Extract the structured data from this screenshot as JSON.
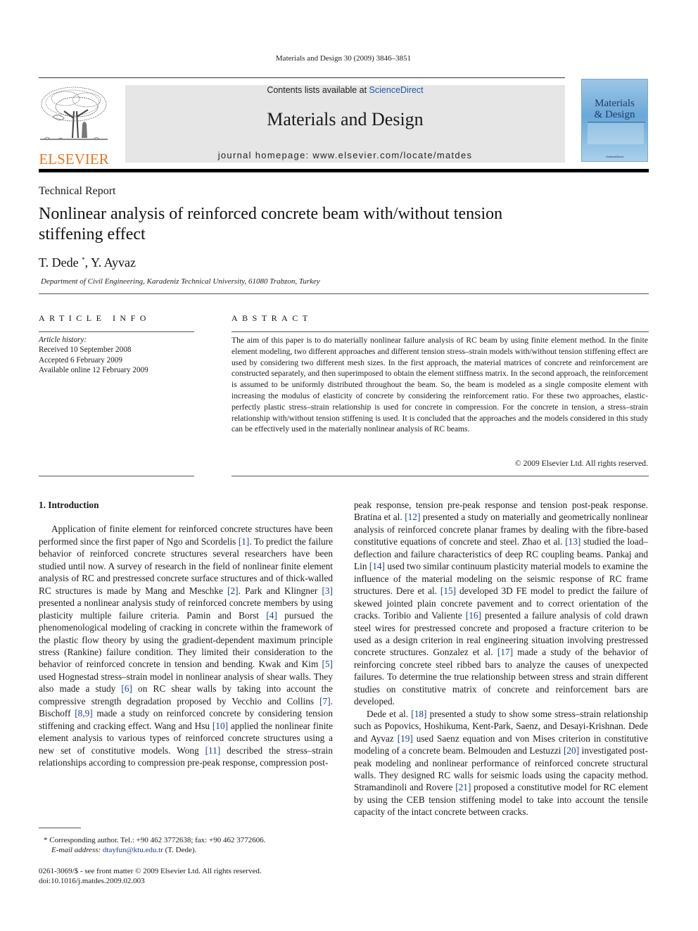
{
  "header": {
    "journal_ref": "Materials and Design 30 (2009) 3846–3851",
    "contents_prefix": "Contents lists available at ",
    "contents_link": "ScienceDirect",
    "journal_title": "Materials and Design",
    "homepage": "journal homepage: www.elsevier.com/locate/matdes",
    "publisher_logo_text": "ELSEVIER",
    "cover": {
      "title_line1": "Materials",
      "title_line2": "& Design",
      "footer": "ScienceDirect"
    },
    "colors": {
      "elsevier_orange": "#e87722",
      "link_blue": "#1e5aa8",
      "banner_gray": "#e6e6e6"
    }
  },
  "article": {
    "section_type": "Technical Report",
    "title": "Nonlinear analysis of reinforced concrete beam with/without tension stiffening effect",
    "authors": [
      {
        "name": "T. Dede",
        "mark": "*"
      },
      {
        "name": "Y. Ayvaz",
        "mark": ""
      }
    ],
    "author_separator": ", ",
    "affiliation": "Department of Civil Engineering, Karadeniz Technical University, 61080 Trabzon, Turkey"
  },
  "article_info": {
    "heading": "ARTICLE INFO",
    "history_label": "Article history:",
    "received": "Received 10 September 2008",
    "accepted": "Accepted 6 February 2009",
    "online": "Available online 12 February 2009"
  },
  "abstract": {
    "heading": "ABSTRACT",
    "text": "The aim of this paper is to do materially nonlinear failure analysis of RC beam by using finite element method. In the finite element modeling, two different approaches and different tension stress–strain models with/without tension stiffening effect are used by considering two different mesh sizes. In the first approach, the material matrices of concrete and reinforcement are constructed separately, and then superimposed to obtain the element stiffness matrix. In the second approach, the reinforcement is assumed to be uniformly distributed throughout the beam. So, the beam is modeled as a single composite element with increasing the modulus of elasticity of concrete by considering the reinforcement ratio. For these two approaches, elastic-perfectly plastic stress–strain relationship is used for concrete in compression. For the concrete in tension, a stress–strain relationship with/without tension stiffening is used. It is concluded that the approaches and the models considered in this study can be effectively used in the materially nonlinear analysis of RC beams.",
    "copyright": "© 2009 Elsevier Ltd. All rights reserved."
  },
  "body": {
    "section_heading": "1. Introduction",
    "left_paragraph": [
      {
        "t": "Application of finite element for reinforced concrete structures have been performed since the first paper of Ngo and Scordelis "
      },
      {
        "r": "[1]"
      },
      {
        "t": ". To predict the failure behavior of reinforced concrete struc­tures several researchers have been studied until now. A survey of research in the field of nonlinear finite element analysis of RC and prestressed concrete surface structures and of thick-walled RC structures is made by Mang and Meschke "
      },
      {
        "r": "[2]"
      },
      {
        "t": ". Park and Klingner "
      },
      {
        "r": "[3]"
      },
      {
        "t": " presented a nonlinear analysis study of reinforced concrete members by using plasticity multiple failure criteria. Pamin and Borst "
      },
      {
        "r": "[4]"
      },
      {
        "t": " pursued the phenomenological modeling of cracking in concrete within the framework of the plastic flow theory by using the gradient-dependent maximum principle stress (Rankine) fail­ure condition. They limited their consideration to the behavior of reinforced concrete in tension and bending. Kwak and Kim "
      },
      {
        "r": "[5]"
      },
      {
        "t": " used Hognestad stress–strain model in nonlinear analysis of shear walls. They also made a study "
      },
      {
        "r": "[6]"
      },
      {
        "t": " on RC shear walls by taking into ac­count the compressive strength degradation proposed by Vecchio and Collins "
      },
      {
        "r": "[7]"
      },
      {
        "t": ". Bischoff "
      },
      {
        "r": "[8,9]"
      },
      {
        "t": " made a study on reinforced concrete by considering tension stiffening and cracking effect. Wang and Hsu "
      },
      {
        "r": "[10]"
      },
      {
        "t": " applied the nonlinear finite element analysis to various types of reinforced concrete structures using a new set of constitu­tive models. Wong "
      },
      {
        "r": "[11]"
      },
      {
        "t": " described the stress–strain relationships according to compression pre-peak response, compression post-"
      }
    ],
    "right_paragraph_1": [
      {
        "t": "peak response, tension pre-peak response and tension post-peak response. Bratina et al. "
      },
      {
        "r": "[12]"
      },
      {
        "t": " presented a study on materially and geometrically nonlinear analysis of reinforced concrete planar frames by dealing with the fibre-based constitutive equations of concrete and steel. Zhao et al. "
      },
      {
        "r": "[13]"
      },
      {
        "t": " studied the load–deflection and failure characteristics of deep RC coupling beams. Pankaj and Lin "
      },
      {
        "r": "[14]"
      },
      {
        "t": " used two similar continuum plasticity material models to examine the influence of the material modeling on the seismic response of RC frame structures. Dere et al. "
      },
      {
        "r": "[15]"
      },
      {
        "t": " developed 3D FE model to predict the failure of skewed jointed plain concrete pave­ment and to correct orientation of the cracks. Toribio and Valiente "
      },
      {
        "r": "[16]"
      },
      {
        "t": " presented a failure analysis of cold drawn steel wires for pre­stressed concrete and proposed a fracture criterion to be used as a design criterion in real engineering situation involving prestressed concrete structures. Gonzalez et al. "
      },
      {
        "r": "[17]"
      },
      {
        "t": " made a study of the behav­ior of reinforcing concrete steel ribbed bars to analyze the causes of unexpected failures. To determine the true relationship between stress and strain different studies on constitutive matrix of con­crete and reinforcement bars are developed."
      }
    ],
    "right_paragraph_2": [
      {
        "t": "Dede et al. "
      },
      {
        "r": "[18]"
      },
      {
        "t": " presented a study to show some stress–strain relationship such as Popovics, Hoshikuma, Kent-Park, Saenz, and Desayi-Krishnan. Dede and Ayvaz "
      },
      {
        "r": "[19]"
      },
      {
        "t": " used Saenz equation and von Mises criterion in constitutive modeling of a concrete beam. Bel­mouden and Lestuzzi "
      },
      {
        "r": "[20]"
      },
      {
        "t": " investigated post-peak modeling and nonlinear performance of reinforced concrete structural walls. They designed RC walls for seismic loads using the capacity method. Stra­mandinoli and Rovere "
      },
      {
        "r": "[21]"
      },
      {
        "t": " proposed a constitutive model for RC ele­ment by using the CEB tension stiffening model to take into account the tensile capacity of the intact concrete between cracks."
      }
    ]
  },
  "footnote": {
    "mark": "*",
    "corresponding": "Corresponding author. Tel.: +90 462 3772638; fax: +90 462 3772606.",
    "email_label": "E-mail address:",
    "email": "dtayfun@ktu.edu.tr",
    "email_suffix": " (T. Dede)."
  },
  "front_matter": {
    "issn": "0261-3069/$ - see front matter © 2009 Elsevier Ltd. All rights reserved.",
    "doi": "doi:10.1016/j.matdes.2009.02.003"
  }
}
